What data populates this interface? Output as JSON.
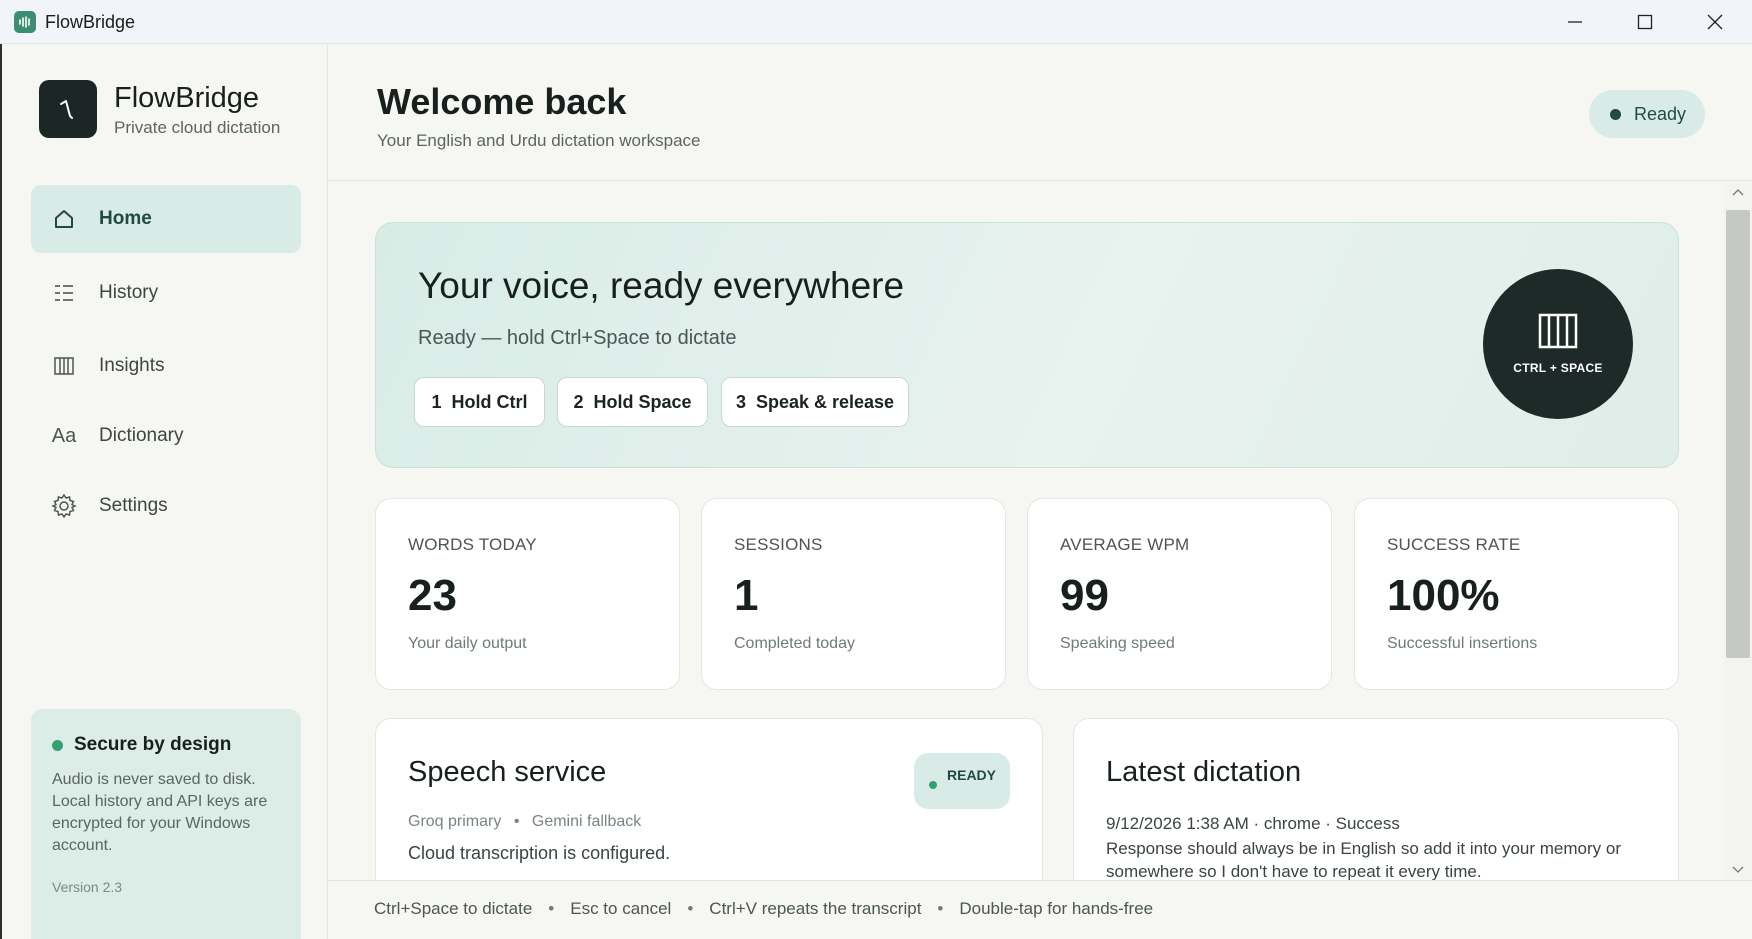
{
  "window": {
    "title": "FlowBridge"
  },
  "brand": {
    "name": "FlowBridge",
    "tagline": "Private cloud dictation"
  },
  "sidebar": {
    "items": [
      {
        "label": "Home",
        "icon": "home-icon",
        "active": true
      },
      {
        "label": "History",
        "icon": "list-icon",
        "active": false
      },
      {
        "label": "Insights",
        "icon": "bars-icon",
        "active": false
      },
      {
        "label": "Dictionary",
        "icon": "font-icon",
        "active": false
      },
      {
        "label": "Settings",
        "icon": "gear-icon",
        "active": false
      }
    ],
    "secure": {
      "title": "Secure by design",
      "text": "Audio is never saved to disk. Local history and API keys are encrypted for your Windows account.",
      "version": "Version 2.3"
    }
  },
  "header": {
    "title": "Welcome back",
    "subtitle": "Your English and Urdu dictation workspace",
    "status": "Ready"
  },
  "hero": {
    "title": "Your voice, ready everywhere",
    "subtitle": "Ready — hold Ctrl+Space to dictate",
    "steps": [
      {
        "num": "1",
        "label": "Hold Ctrl"
      },
      {
        "num": "2",
        "label": "Hold Space"
      },
      {
        "num": "3",
        "label": "Speak & release"
      }
    ],
    "shortcut_label": "CTRL + SPACE"
  },
  "stats": [
    {
      "label": "WORDS TODAY",
      "value": "23",
      "caption": "Your daily output"
    },
    {
      "label": "SESSIONS",
      "value": "1",
      "caption": "Completed today"
    },
    {
      "label": "AVERAGE WPM",
      "value": "99",
      "caption": "Speaking speed"
    },
    {
      "label": "SUCCESS RATE",
      "value": "100%",
      "caption": "Successful insertions"
    }
  ],
  "speech_service": {
    "title": "Speech service",
    "badge": "READY",
    "primary": "Groq primary",
    "fallback": "Gemini fallback",
    "status": "Cloud transcription is configured."
  },
  "latest_dictation": {
    "title": "Latest dictation",
    "meta": "9/12/2026 1:38 AM · chrome · Success",
    "text": "Response should always be in English so add it into your memory or somewhere so I don't have to repeat it every time."
  },
  "footer": {
    "hints": [
      "Ctrl+Space to dictate",
      "Esc to cancel",
      "Ctrl+V repeats the transcript",
      "Double-tap for hands-free"
    ]
  },
  "colors": {
    "accent": "#1f4b41",
    "accent_soft": "#d9ebe6",
    "success": "#2fa36f",
    "dark": "#1d2a27"
  }
}
